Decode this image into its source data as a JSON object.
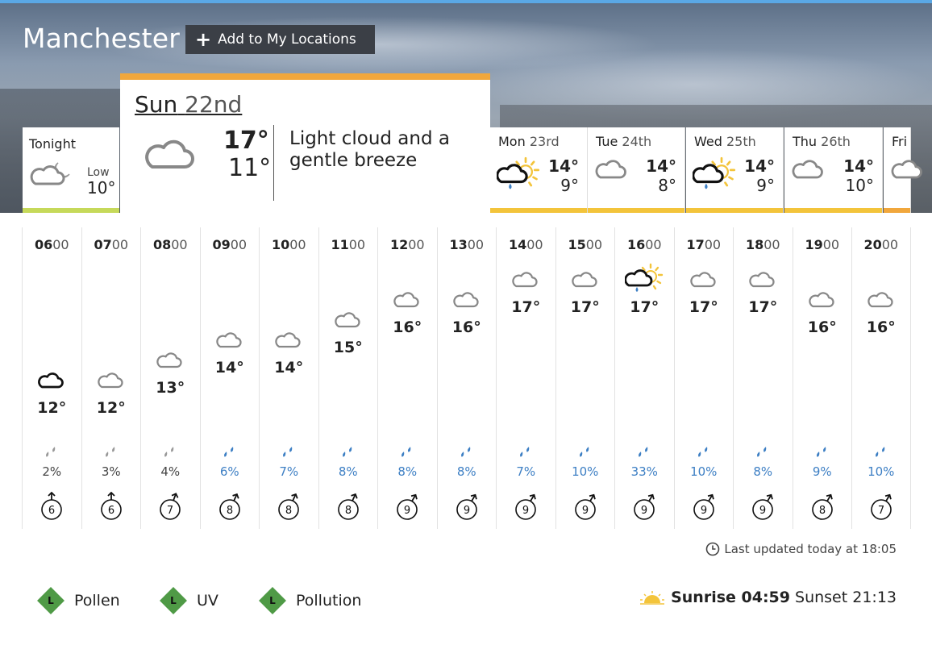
{
  "location": {
    "name": "Manchester",
    "add_label": "Add to My Locations"
  },
  "tonight": {
    "label": "Tonight",
    "low_label": "Low",
    "low": "10°"
  },
  "today": {
    "day": "Sun",
    "date": "22nd",
    "high": "17°",
    "low": "11°",
    "description": "Light cloud and a gentle breeze"
  },
  "days": [
    {
      "day": "Mon",
      "date": "23rd",
      "high": "14°",
      "low": "9°",
      "icon": "sun-cloud-rain-icon"
    },
    {
      "day": "Tue",
      "date": "24th",
      "high": "14°",
      "low": "8°",
      "icon": "cloud-icon"
    },
    {
      "day": "Wed",
      "date": "25th",
      "high": "14°",
      "low": "9°",
      "icon": "sun-cloud-rain-icon"
    },
    {
      "day": "Thu",
      "date": "26th",
      "high": "14°",
      "low": "10°",
      "icon": "cloud-icon"
    },
    {
      "day": "Fri",
      "date": ""
    }
  ],
  "hourly": [
    {
      "hh": "06",
      "mm": "00",
      "temp": "12°",
      "rain": "2%",
      "wind": "6",
      "icon": "black-cloud-icon"
    },
    {
      "hh": "07",
      "mm": "00",
      "temp": "12°",
      "rain": "3%",
      "wind": "6",
      "icon": "cloud-icon"
    },
    {
      "hh": "08",
      "mm": "00",
      "temp": "13°",
      "rain": "4%",
      "wind": "7",
      "icon": "cloud-icon"
    },
    {
      "hh": "09",
      "mm": "00",
      "temp": "14°",
      "rain": "6%",
      "wind": "8",
      "icon": "cloud-icon"
    },
    {
      "hh": "10",
      "mm": "00",
      "temp": "14°",
      "rain": "7%",
      "wind": "8",
      "icon": "cloud-icon"
    },
    {
      "hh": "11",
      "mm": "00",
      "temp": "15°",
      "rain": "8%",
      "wind": "8",
      "icon": "cloud-icon"
    },
    {
      "hh": "12",
      "mm": "00",
      "temp": "16°",
      "rain": "8%",
      "wind": "9",
      "icon": "cloud-icon"
    },
    {
      "hh": "13",
      "mm": "00",
      "temp": "16°",
      "rain": "8%",
      "wind": "9",
      "icon": "cloud-icon"
    },
    {
      "hh": "14",
      "mm": "00",
      "temp": "17°",
      "rain": "7%",
      "wind": "9",
      "icon": "cloud-icon"
    },
    {
      "hh": "15",
      "mm": "00",
      "temp": "17°",
      "rain": "10%",
      "wind": "9",
      "icon": "cloud-icon"
    },
    {
      "hh": "16",
      "mm": "00",
      "temp": "17°",
      "rain": "33%",
      "wind": "9",
      "icon": "sun-cloud-rain-icon"
    },
    {
      "hh": "17",
      "mm": "00",
      "temp": "17°",
      "rain": "10%",
      "wind": "9",
      "icon": "cloud-icon"
    },
    {
      "hh": "18",
      "mm": "00",
      "temp": "17°",
      "rain": "8%",
      "wind": "9",
      "icon": "cloud-icon"
    },
    {
      "hh": "19",
      "mm": "00",
      "temp": "16°",
      "rain": "9%",
      "wind": "8",
      "icon": "cloud-icon"
    },
    {
      "hh": "20",
      "mm": "00",
      "temp": "16°",
      "rain": "10%",
      "wind": "7",
      "icon": "cloud-icon"
    }
  ],
  "updated": "Last updated today at 18:05",
  "badges": [
    {
      "level": "L",
      "label": "Pollen"
    },
    {
      "level": "L",
      "label": "UV"
    },
    {
      "level": "L",
      "label": "Pollution"
    }
  ],
  "sun": {
    "sunrise": "Sunrise 04:59",
    "sunset": "Sunset 21:13"
  },
  "colors": {
    "today_bar": "#f1a73c",
    "tonight_bar": "#c6d95a",
    "day_bar": "#f3c43b",
    "rain_blue": "#3d7fc4",
    "badge_green": "#4f9a46"
  }
}
